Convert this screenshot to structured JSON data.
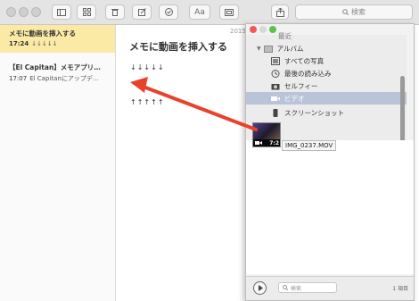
{
  "toolbar": {
    "search_placeholder": "検索",
    "font_button_label": "Aa",
    "buttons": [
      "sidebar-toggle",
      "attachments-grid",
      "delete",
      "new-note",
      "checklist",
      "font",
      "table",
      "share"
    ]
  },
  "notes": [
    {
      "title": "メモに動画を挿入する",
      "time": "17:24",
      "preview": "↓↓↓↓↓",
      "selected": true
    },
    {
      "title": "【El Capitan】メモアプリ…",
      "time": "17:07",
      "preview": "El Capitanにアップデ…",
      "selected": false
    }
  ],
  "editor": {
    "date": "2015",
    "title": "メモに動画を挿入する",
    "line1": "↓↓↓↓↓",
    "line2": "↑↑↑↑↑"
  },
  "photo_browser": {
    "partial_top_item": "最近",
    "album_header": "アルバム",
    "items": [
      {
        "label": "すべての写真",
        "icon": "photos-icon",
        "selected": false
      },
      {
        "label": "最後の読み込み",
        "icon": "clock-icon",
        "selected": false
      },
      {
        "label": "セルフィー",
        "icon": "camera-icon",
        "selected": false
      },
      {
        "label": "ビデオ",
        "icon": "video-icon",
        "selected": true
      },
      {
        "label": "スクリーンショット",
        "icon": "phone-icon",
        "selected": false
      }
    ],
    "thumbnail_duration": "7:2",
    "tooltip": "IMG_0237.MOV",
    "search_placeholder": "検索",
    "item_count": "1 項目"
  },
  "colors": {
    "selected_note": "#fbeaa6",
    "arrow": "#e8432a",
    "selected_album": "#b9c4d9"
  }
}
